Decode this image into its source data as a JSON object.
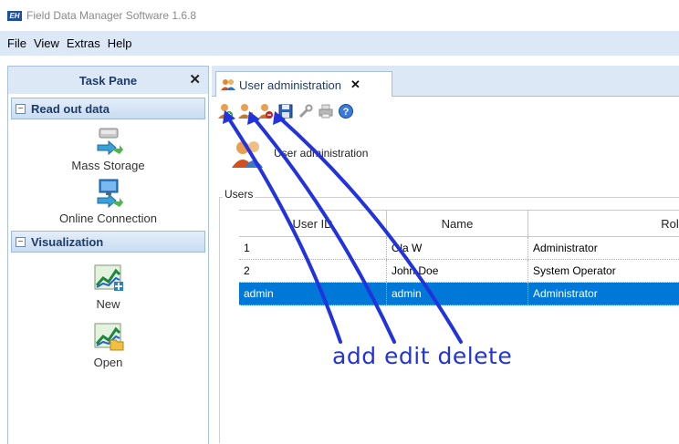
{
  "window": {
    "logo": "EH",
    "title": "Field Data Manager Software 1.6.8"
  },
  "menu": [
    "File",
    "View",
    "Extras",
    "Help"
  ],
  "task_pane": {
    "title": "Task Pane",
    "close": "✕",
    "sections": [
      {
        "title": "Read out data",
        "toggle": "⊟",
        "items": [
          "Mass Storage",
          "Online Connection"
        ]
      },
      {
        "title": "Visualization",
        "toggle": "⊟",
        "items": [
          "New",
          "Open"
        ]
      }
    ]
  },
  "tab": {
    "label": "User administration",
    "close": "✕"
  },
  "toolbar": {
    "icons": [
      "add-user-icon",
      "edit-user-icon",
      "delete-user-icon",
      "save-icon",
      "settings-icon",
      "print-icon",
      "help-icon"
    ]
  },
  "content": {
    "header_title": "User administration",
    "group_label": "Users",
    "columns": [
      "User ID",
      "Name",
      "Role"
    ],
    "rows": [
      {
        "id": "1",
        "name": "Ola W",
        "role": "Administrator",
        "selected": false
      },
      {
        "id": "2",
        "name": "John Doe",
        "role": "System Operator",
        "selected": false
      },
      {
        "id": "admin",
        "name": "admin",
        "role": "Administrator",
        "selected": true
      }
    ]
  },
  "annotation": {
    "text": "add edit delete",
    "color": "#2233dd"
  },
  "colors": {
    "accent": "#0078d7",
    "pane_header": "#dce8f6",
    "annotation": "#2233dd"
  }
}
